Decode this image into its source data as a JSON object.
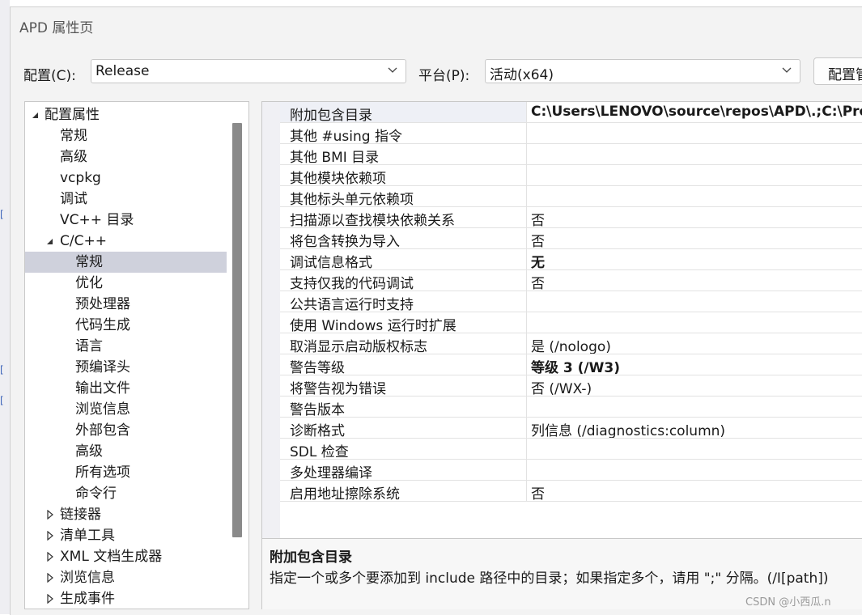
{
  "window": {
    "title": "APD 属性页"
  },
  "toolbar": {
    "config_label": "配置(C):",
    "config_value": "Release",
    "platform_label": "平台(P):",
    "platform_value": "活动(x64)",
    "manager_button": "配置管理器"
  },
  "tree": {
    "items": [
      {
        "label": "配置属性",
        "arrow": "expanded"
      },
      {
        "label": "常规"
      },
      {
        "label": "高级"
      },
      {
        "label": "vcpkg"
      },
      {
        "label": "调试"
      },
      {
        "label": "VC++ 目录"
      },
      {
        "label": "C/C++",
        "arrow": "expanded"
      },
      {
        "label": "常规",
        "selected": true
      },
      {
        "label": "优化"
      },
      {
        "label": "预处理器"
      },
      {
        "label": "代码生成"
      },
      {
        "label": "语言"
      },
      {
        "label": "预编译头"
      },
      {
        "label": "输出文件"
      },
      {
        "label": "浏览信息"
      },
      {
        "label": "外部包含"
      },
      {
        "label": "高级"
      },
      {
        "label": "所有选项"
      },
      {
        "label": "命令行"
      },
      {
        "label": "链接器",
        "arrow": "collapsed"
      },
      {
        "label": "清单工具",
        "arrow": "collapsed"
      },
      {
        "label": "XML 文档生成器",
        "arrow": "collapsed"
      },
      {
        "label": "浏览信息",
        "arrow": "collapsed"
      },
      {
        "label": "生成事件",
        "arrow": "collapsed"
      }
    ]
  },
  "grid": {
    "rows": [
      {
        "name": "附加包含目录",
        "value": "C:\\Users\\LENOVO\\source\\repos\\APD\\.;C:\\Pro",
        "bold": true,
        "selected": true
      },
      {
        "name": "其他 #using 指令",
        "value": ""
      },
      {
        "name": "其他 BMI 目录",
        "value": ""
      },
      {
        "name": "其他模块依赖项",
        "value": ""
      },
      {
        "name": "其他标头单元依赖项",
        "value": ""
      },
      {
        "name": "扫描源以查找模块依赖关系",
        "value": "否"
      },
      {
        "name": "将包含转换为导入",
        "value": "否"
      },
      {
        "name": "调试信息格式",
        "value": "无",
        "bold": true
      },
      {
        "name": "支持仅我的代码调试",
        "value": "否"
      },
      {
        "name": "公共语言运行时支持",
        "value": ""
      },
      {
        "name": "使用 Windows 运行时扩展",
        "value": ""
      },
      {
        "name": "取消显示启动版权标志",
        "value": "是 (/nologo)"
      },
      {
        "name": "警告等级",
        "value": "等级 3 (/W3)",
        "bold": true
      },
      {
        "name": "将警告视为错误",
        "value": "否 (/WX-)"
      },
      {
        "name": "警告版本",
        "value": ""
      },
      {
        "name": "诊断格式",
        "value": "列信息 (/diagnostics:column)"
      },
      {
        "name": "SDL 检查",
        "value": ""
      },
      {
        "name": "多处理器编译",
        "value": ""
      },
      {
        "name": "启用地址擦除系统",
        "value": "否"
      }
    ]
  },
  "description": {
    "title": "附加包含目录",
    "text": "指定一个或多个要添加到 include 路径中的目录；如果指定多个，请用 \";\" 分隔。(/I[path])"
  },
  "watermark": "CSDN @小西瓜.n",
  "colors": {
    "selection": "#cfd1dc",
    "scrollbar": "#8a8a8a"
  }
}
